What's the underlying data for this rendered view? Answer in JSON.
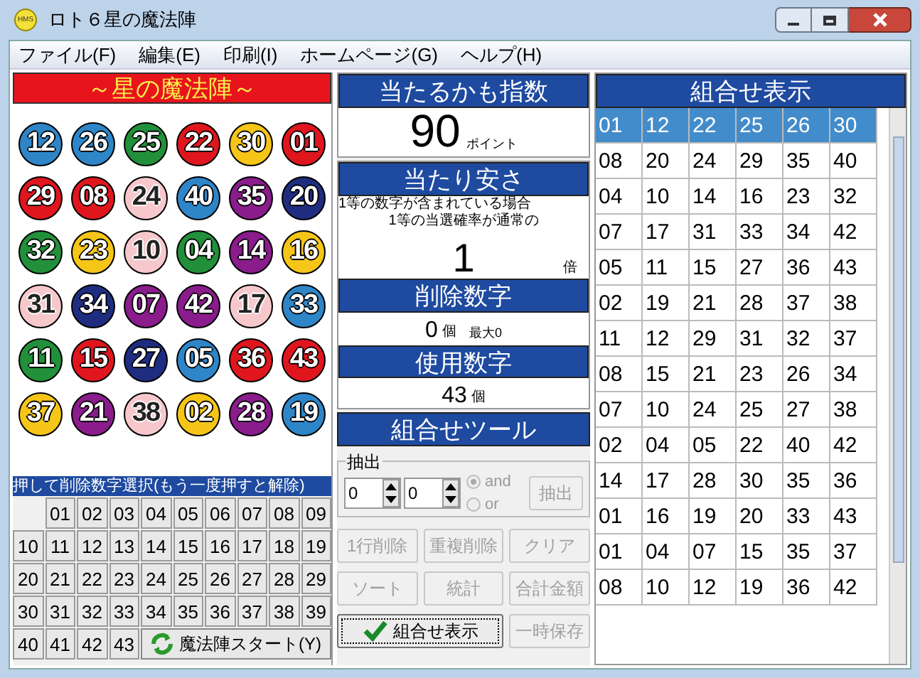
{
  "window": {
    "title": "ロト６星の魔法陣",
    "icon_text": "HMS"
  },
  "menu": [
    "ファイル(F)",
    "編集(E)",
    "印刷(I)",
    "ホームページ(G)",
    "ヘルプ(H)"
  ],
  "magic_square": {
    "title": "～星の魔法陣～",
    "balls": [
      {
        "number": "12",
        "color": "#2e86c8"
      },
      {
        "number": "26",
        "color": "#2e86c8"
      },
      {
        "number": "25",
        "color": "#22903a"
      },
      {
        "number": "22",
        "color": "#e0161e"
      },
      {
        "number": "30",
        "color": "#f5c518"
      },
      {
        "number": "01",
        "color": "#e0161e"
      },
      {
        "number": "29",
        "color": "#e0161e"
      },
      {
        "number": "08",
        "color": "#e0161e"
      },
      {
        "number": "24",
        "color": "#f6c8cc"
      },
      {
        "number": "40",
        "color": "#2e86c8"
      },
      {
        "number": "35",
        "color": "#8a1c8c"
      },
      {
        "number": "20",
        "color": "#1f2d80"
      },
      {
        "number": "32",
        "color": "#22903a"
      },
      {
        "number": "23",
        "color": "#f5c518"
      },
      {
        "number": "10",
        "color": "#f6c8cc"
      },
      {
        "number": "04",
        "color": "#22903a"
      },
      {
        "number": "14",
        "color": "#8a1c8c"
      },
      {
        "number": "16",
        "color": "#f5c518"
      },
      {
        "number": "31",
        "color": "#f6c8cc"
      },
      {
        "number": "34",
        "color": "#1f2d80"
      },
      {
        "number": "07",
        "color": "#8a1c8c"
      },
      {
        "number": "42",
        "color": "#8a1c8c"
      },
      {
        "number": "17",
        "color": "#f6c8cc"
      },
      {
        "number": "33",
        "color": "#2e86c8"
      },
      {
        "number": "11",
        "color": "#22903a"
      },
      {
        "number": "15",
        "color": "#e0161e"
      },
      {
        "number": "27",
        "color": "#1f2d80"
      },
      {
        "number": "05",
        "color": "#2e86c8"
      },
      {
        "number": "36",
        "color": "#e0161e"
      },
      {
        "number": "43",
        "color": "#e0161e"
      },
      {
        "number": "37",
        "color": "#f5c518"
      },
      {
        "number": "21",
        "color": "#8a1c8c"
      },
      {
        "number": "38",
        "color": "#f6c8cc"
      },
      {
        "number": "02",
        "color": "#f5c518"
      },
      {
        "number": "28",
        "color": "#8a1c8c"
      },
      {
        "number": "19",
        "color": "#2e86c8"
      }
    ]
  },
  "delete_picker": {
    "title": "押して削除数字選択(もう一度押すと解除)",
    "numbers": [
      "01",
      "02",
      "03",
      "04",
      "05",
      "06",
      "07",
      "08",
      "09",
      "10",
      "11",
      "12",
      "13",
      "14",
      "15",
      "16",
      "17",
      "18",
      "19",
      "20",
      "21",
      "22",
      "23",
      "24",
      "25",
      "26",
      "27",
      "28",
      "29",
      "30",
      "31",
      "32",
      "33",
      "34",
      "35",
      "36",
      "37",
      "38",
      "39",
      "40",
      "41",
      "42",
      "43"
    ],
    "start_button": "魔法陣スタート(Y)"
  },
  "hit_index": {
    "title": "当たるかも指数",
    "value": "90",
    "unit": "ポイント"
  },
  "hit_ease": {
    "title": "当たり安さ",
    "line_1": "1等の数字が含まれている場合",
    "line_2": "1等の当選確率が通常の",
    "value": "1",
    "unit": "倍"
  },
  "deleted_numbers": {
    "title": "削除数字",
    "value": "0",
    "unit": "個",
    "max": "最大0"
  },
  "used_numbers": {
    "title": "使用数字",
    "value": "43",
    "unit": "個"
  },
  "tools": {
    "title": "組合せツール",
    "extract": {
      "legend": "抽出",
      "spinner_1": "0",
      "spinner_2": "0",
      "options": [
        {
          "label": "and",
          "selected": true
        },
        {
          "label": "or",
          "selected": false
        }
      ],
      "button": {
        "label": "抽出",
        "disabled": true
      }
    },
    "buttons": [
      {
        "label": "1行削除",
        "disabled": true,
        "kind": "plain"
      },
      {
        "label": "重複削除",
        "disabled": true,
        "kind": "plain"
      },
      {
        "label": "クリア",
        "disabled": true,
        "kind": "plain"
      },
      {
        "label": "ソート",
        "disabled": true,
        "kind": "plain"
      },
      {
        "label": "統計",
        "disabled": true,
        "kind": "plain"
      },
      {
        "label": "合計金額",
        "disabled": true,
        "kind": "plain"
      },
      {
        "label": "組合せ表示",
        "disabled": false,
        "kind": "check"
      },
      {
        "label": "一時保存",
        "disabled": true,
        "kind": "plain"
      }
    ]
  },
  "combinations": {
    "title": "組合せ表示",
    "rows": [
      {
        "cells": [
          "01",
          "12",
          "22",
          "25",
          "26",
          "30"
        ],
        "selected": true
      },
      {
        "cells": [
          "08",
          "20",
          "24",
          "29",
          "35",
          "40"
        ],
        "selected": false
      },
      {
        "cells": [
          "04",
          "10",
          "14",
          "16",
          "23",
          "32"
        ],
        "selected": false
      },
      {
        "cells": [
          "07",
          "17",
          "31",
          "33",
          "34",
          "42"
        ],
        "selected": false
      },
      {
        "cells": [
          "05",
          "11",
          "15",
          "27",
          "36",
          "43"
        ],
        "selected": false
      },
      {
        "cells": [
          "02",
          "19",
          "21",
          "28",
          "37",
          "38"
        ],
        "selected": false
      },
      {
        "cells": [
          "11",
          "12",
          "29",
          "31",
          "32",
          "37"
        ],
        "selected": false
      },
      {
        "cells": [
          "08",
          "15",
          "21",
          "23",
          "26",
          "34"
        ],
        "selected": false
      },
      {
        "cells": [
          "07",
          "10",
          "24",
          "25",
          "27",
          "38"
        ],
        "selected": false
      },
      {
        "cells": [
          "02",
          "04",
          "05",
          "22",
          "40",
          "42"
        ],
        "selected": false
      },
      {
        "cells": [
          "14",
          "17",
          "28",
          "30",
          "35",
          "36"
        ],
        "selected": false
      },
      {
        "cells": [
          "01",
          "16",
          "19",
          "20",
          "33",
          "43"
        ],
        "selected": false
      },
      {
        "cells": [
          "01",
          "04",
          "07",
          "15",
          "35",
          "37"
        ],
        "selected": false
      },
      {
        "cells": [
          "08",
          "10",
          "12",
          "19",
          "36",
          "42"
        ],
        "selected": false
      }
    ]
  }
}
